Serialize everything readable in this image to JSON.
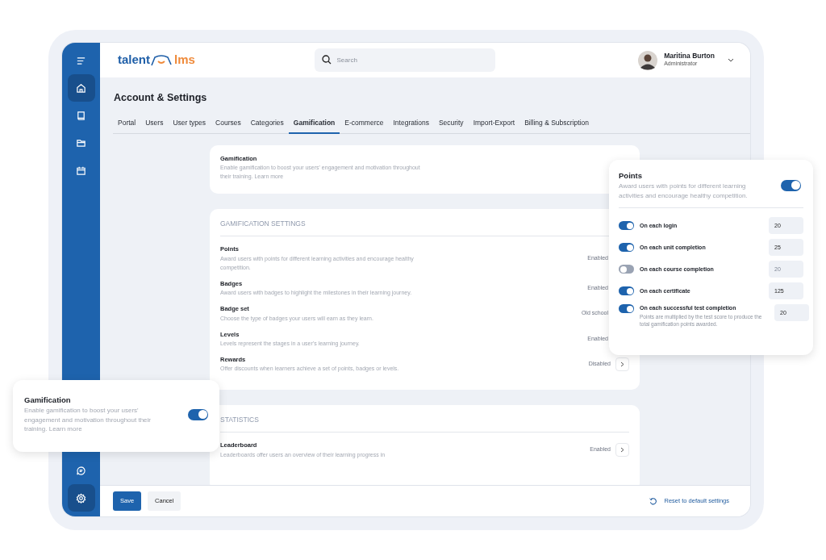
{
  "logo": {
    "part_1": "talent",
    "part_2": "lms"
  },
  "search": {
    "placeholder": "Search"
  },
  "user": {
    "name": "Maritina Burton",
    "role": "Administrator"
  },
  "sidebar": {
    "top_items": [
      {
        "kind": "menu",
        "selected": false
      },
      {
        "kind": "home",
        "selected": true
      },
      {
        "kind": "book",
        "selected": false
      },
      {
        "kind": "folder",
        "selected": false
      },
      {
        "kind": "calendar",
        "selected": false
      }
    ],
    "bottom_items": [
      {
        "kind": "chat",
        "selected": false
      },
      {
        "kind": "settings",
        "selected": true
      }
    ]
  },
  "page_title": "Account & Settings",
  "tabs": [
    {
      "label": "Portal",
      "selected": false
    },
    {
      "label": "Users",
      "selected": false
    },
    {
      "label": "User types",
      "selected": false
    },
    {
      "label": "Courses",
      "selected": false
    },
    {
      "label": "Categories",
      "selected": false
    },
    {
      "label": "Gamification",
      "selected": true
    },
    {
      "label": "E-commerce",
      "selected": false
    },
    {
      "label": "Integrations",
      "selected": false
    },
    {
      "label": "Security",
      "selected": false
    },
    {
      "label": "Import-Export",
      "selected": false
    },
    {
      "label": "Billing & Subscription",
      "selected": false
    }
  ],
  "gamification_card": {
    "title": "Gamification",
    "description": "Enable gamification to boost your users' engagement and motivation throughout their training. Learn more"
  },
  "sections": [
    {
      "heading": "GAMIFICATION SETTINGS",
      "rows": [
        {
          "title": "Points",
          "description": "Award users with points for different learning activities and encourage healthy competition.",
          "status": "Enabled",
          "button": false
        },
        {
          "title": "Badges",
          "description": "Award users with badges to highlight the milestones in their learning journey.",
          "status": "Enabled",
          "button": false
        },
        {
          "title": "Badge set",
          "description": "Choose the type of badges your users will earn as they learn.",
          "status": "Old school",
          "button": false
        },
        {
          "title": "Levels",
          "description": "Levels represent the stages in a user's learning journey.",
          "status": "Enabled",
          "button": false
        },
        {
          "title": "Rewards",
          "description": "Offer discounts when learners achieve a set of points, badges or levels.",
          "status": "Disabled",
          "button": true
        }
      ]
    },
    {
      "heading": "STATISTICS",
      "rows": [
        {
          "title": "Leaderboard",
          "description": "Leaderboards offer users an overview of their learning progress in",
          "status": "Enabled",
          "button": true
        }
      ]
    }
  ],
  "footer": {
    "save": "Save",
    "cancel": "Cancel",
    "reset": "Reset to default settings"
  },
  "points_popup": {
    "title": "Points",
    "description": "Award users with points for different learning activities and encourage healthy competition.",
    "on": true,
    "items": [
      {
        "label": "On each login",
        "on": true,
        "value": "20"
      },
      {
        "label": "On each unit completion",
        "on": true,
        "value": "25"
      },
      {
        "label": "On each course completion",
        "on": false,
        "value": "20"
      },
      {
        "label": "On each certificate",
        "on": true,
        "value": "125"
      },
      {
        "label": "On each successful test completion",
        "on": true,
        "value": "20",
        "note": "Points are multiplied by the test score to produce the total gamification points awarded."
      }
    ]
  },
  "gamification_popup": {
    "title": "Gamification",
    "description": "Enable gamification to boost your users' engagement and motivation throughout their training. Learn more",
    "on": true
  }
}
